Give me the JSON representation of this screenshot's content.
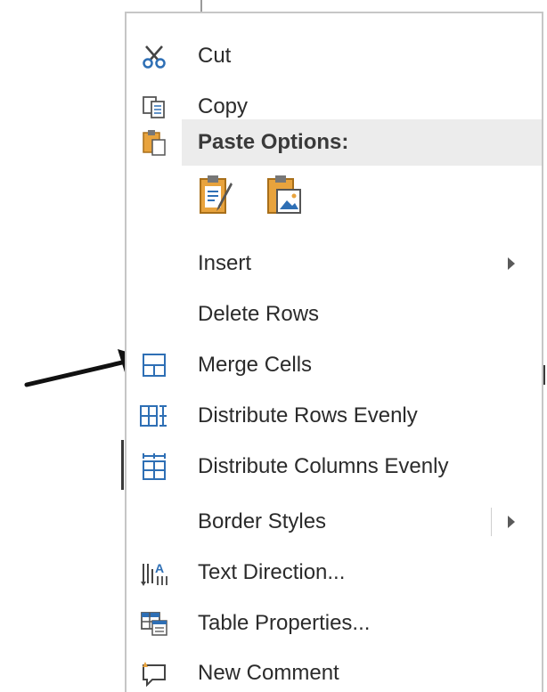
{
  "menu": {
    "cut": "Cut",
    "copy": "Copy",
    "paste_options": "Paste Options:",
    "insert": "Insert",
    "delete_rows": "Delete Rows",
    "merge_cells": "Merge Cells",
    "distribute_rows": "Distribute Rows Evenly",
    "distribute_columns": "Distribute Columns Evenly",
    "border_styles": "Border Styles",
    "text_direction": "Text Direction...",
    "table_properties": "Table Properties...",
    "new_comment": "New Comment"
  },
  "icons": {
    "cut": "scissors-icon",
    "copy": "copy-icon",
    "paste": "paste-icon",
    "paste_keep_formatting": "paste-keep-formatting-icon",
    "paste_picture": "paste-picture-icon",
    "merge_cells": "merge-cells-icon",
    "distribute_rows": "distribute-rows-icon",
    "distribute_columns": "distribute-columns-icon",
    "text_direction": "text-direction-icon",
    "table_properties": "table-properties-icon",
    "new_comment": "new-comment-icon",
    "pointer_arrow": "pointer-arrow-icon"
  },
  "colors": {
    "menu_border": "#c6c6c6",
    "paste_header_bg": "#ececec",
    "icon_blue": "#2e6fb5",
    "icon_orange": "#e8a33d",
    "text": "#2b2b2b"
  }
}
